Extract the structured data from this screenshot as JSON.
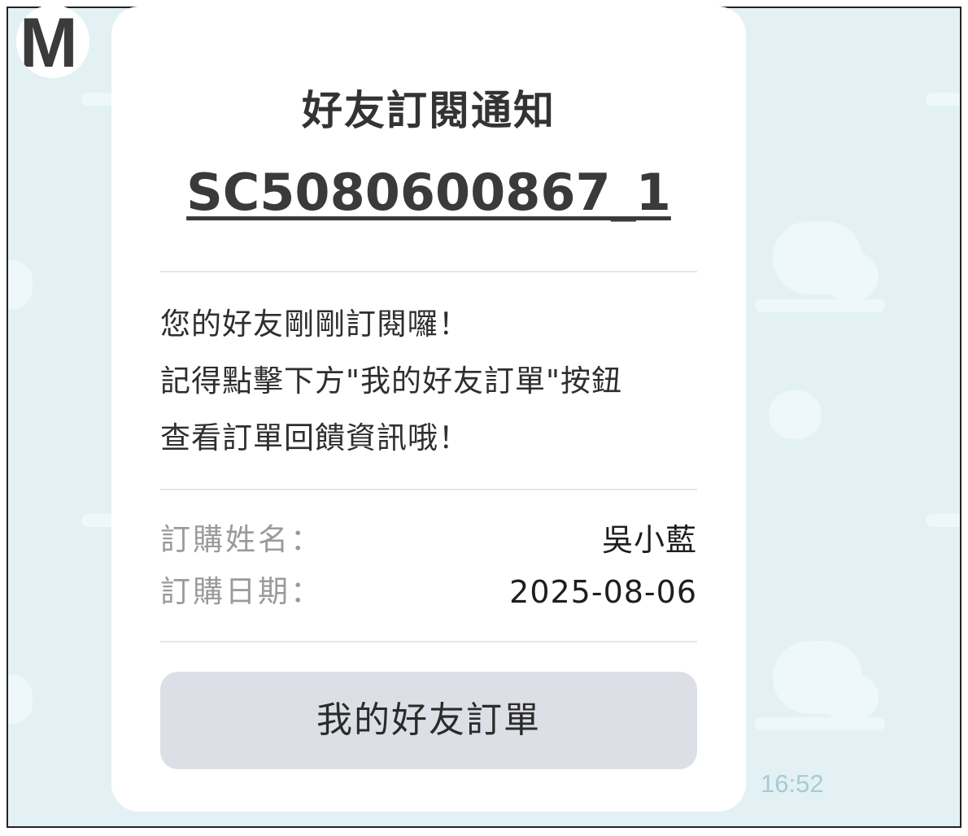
{
  "avatar": {
    "letter": "M"
  },
  "card": {
    "title": "好友訂閱通知",
    "order_number": "SC5080600867_1",
    "message_lines": [
      "您的好友剛剛訂閱囉！",
      "記得點擊下方\"我的好友訂單\"按鈕",
      "查看訂單回饋資訊哦！"
    ],
    "info": {
      "name_label": "訂購姓名：",
      "name_value": "吳小藍",
      "date_label": "訂購日期：",
      "date_value": "2025-08-06"
    },
    "button_label": "我的好友訂單"
  },
  "message_time": "16:52",
  "colors": {
    "chat_background": "#e3f1f4",
    "card_background": "#ffffff",
    "button_background": "#dcdfe6",
    "timestamp": "#a8cbd4"
  }
}
